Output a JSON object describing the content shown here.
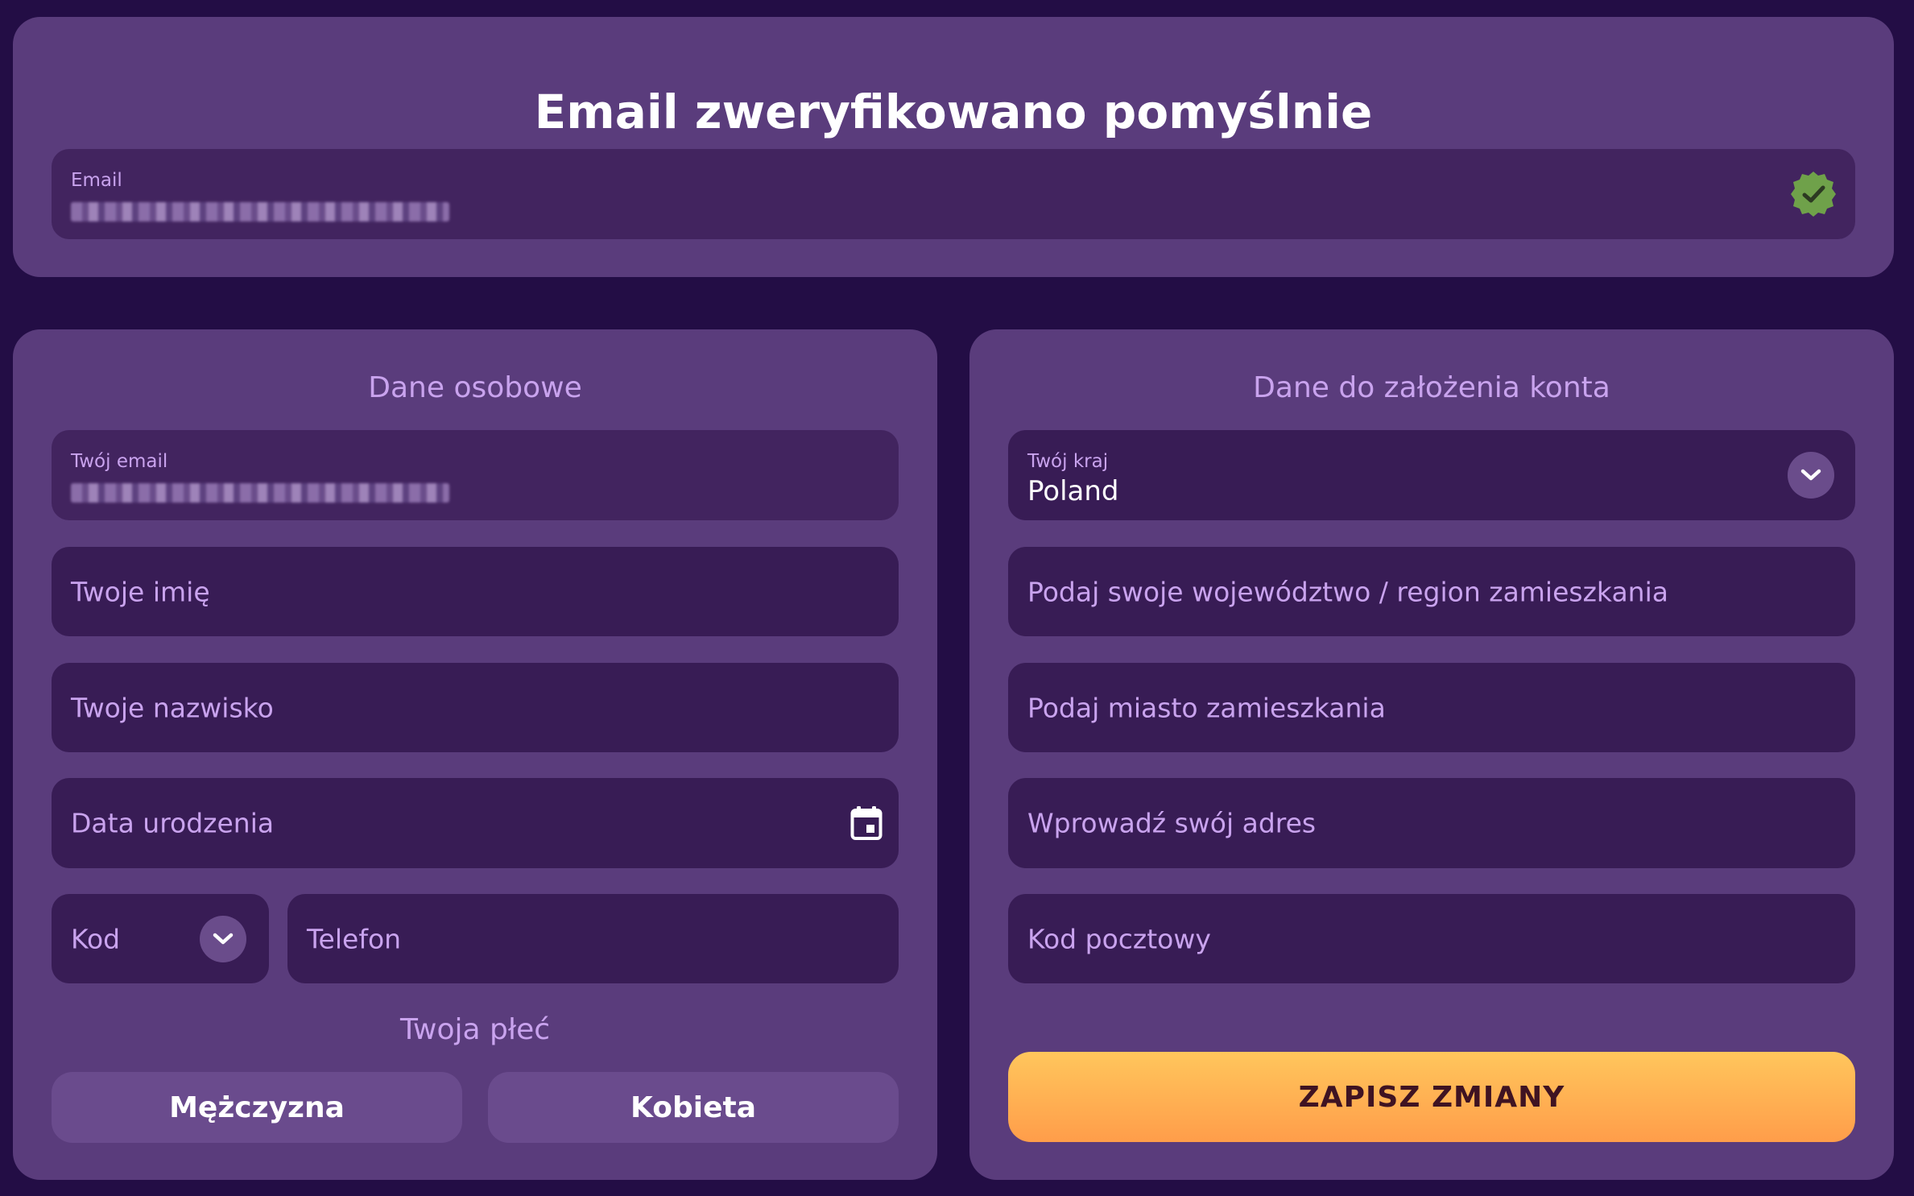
{
  "verification": {
    "title": "Email zweryfikowano pomyślnie",
    "email_label": "Email",
    "email_value": "redacted-email"
  },
  "personal": {
    "section_title": "Dane osobowe",
    "email_label": "Twój email",
    "email_value": "redacted-email",
    "first_name_placeholder": "Twoje imię",
    "last_name_placeholder": "Twoje nazwisko",
    "birth_date_placeholder": "Data urodzenia",
    "code_placeholder": "Kod",
    "phone_placeholder": "Telefon",
    "gender_title": "Twoja płeć",
    "gender_male": "Mężczyzna",
    "gender_female": "Kobieta"
  },
  "account": {
    "section_title": "Dane do założenia konta",
    "country_label": "Twój kraj",
    "country_value": "Poland",
    "region_placeholder": "Podaj swoje województwo / region zamieszkania",
    "city_placeholder": "Podaj miasto zamieszkania",
    "address_placeholder": "Wprowadź swój adres",
    "postal_placeholder": "Kod pocztowy",
    "save_label": "ZAPISZ ZMIANY"
  },
  "colors": {
    "background": "#230d45",
    "panel": "#5a3c7c",
    "field": "#381c55",
    "accent_text": "#c9a3ee",
    "success": "#6fa14a",
    "save_gradient_top": "#ffc65c",
    "save_gradient_bottom": "#ff9d4a"
  },
  "icons": {
    "verified": "check-badge-icon",
    "dropdown": "chevron-down-icon",
    "calendar": "calendar-icon"
  }
}
